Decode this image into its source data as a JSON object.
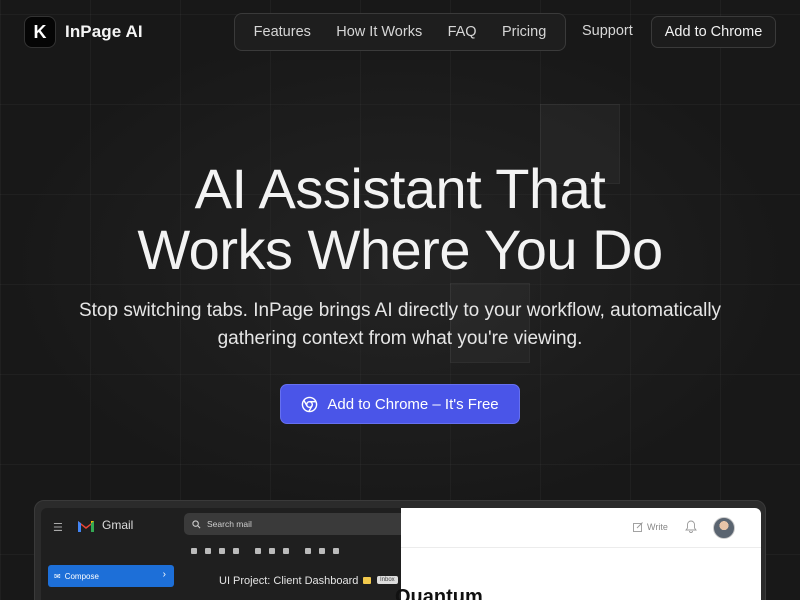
{
  "brand": {
    "logo_letter": "K",
    "name": "InPage AI"
  },
  "nav": {
    "links": [
      {
        "label": "Features"
      },
      {
        "label": "How It Works"
      },
      {
        "label": "FAQ"
      },
      {
        "label": "Pricing"
      }
    ],
    "support_label": "Support",
    "cta_label": "Add to Chrome"
  },
  "hero": {
    "title_line1": "AI Assistant That",
    "title_line2": "Works Where You Do",
    "subtitle_line1": "Stop switching tabs. InPage brings AI directly to your workflow, automatically",
    "subtitle_line2": "gathering context from what you're viewing.",
    "cta_label": "Add to Chrome – It's Free"
  },
  "preview": {
    "gmail": {
      "app_name": "Gmail",
      "search_placeholder": "Search mail",
      "compose_label": "Compose",
      "email_subject": "UI Project: Client Dashboard",
      "badge_label": "Inbox"
    },
    "doc": {
      "write_label": "Write",
      "title": "Quantum"
    }
  },
  "colors": {
    "background": "#181818",
    "accent": "#4a55e8",
    "gmail_compose": "#1d6fd8"
  }
}
